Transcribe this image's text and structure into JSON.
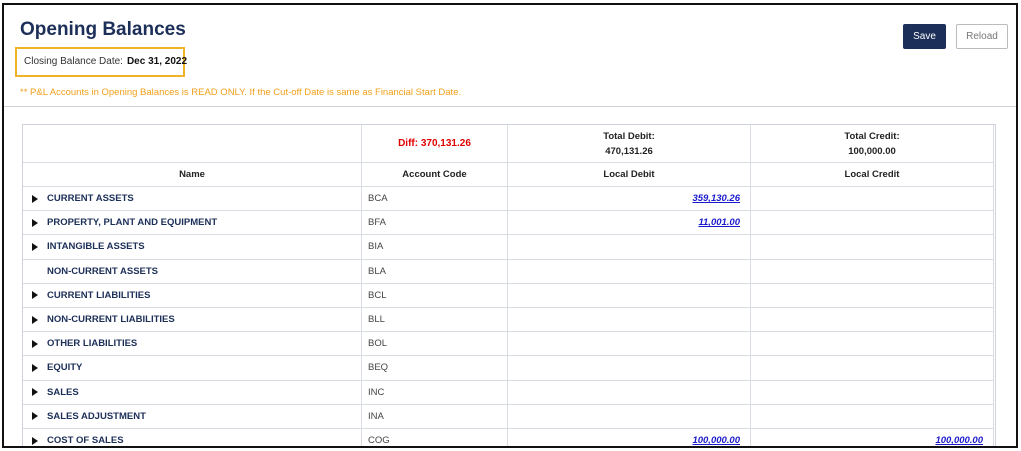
{
  "page": {
    "title": "Opening Balances",
    "closing_label": "Closing Balance Date:",
    "closing_date": "Dec 31, 2022",
    "note": "** P&L Accounts in Opening Balances is READ ONLY. If the Cut-off Date is same as Financial Start Date."
  },
  "toolbar": {
    "save_label": "Save",
    "reload_label": "Reload"
  },
  "summary": {
    "diff": "Diff: 370,131.26",
    "total_debit_label": "Total Debit:",
    "total_debit_value": "470,131.26",
    "total_credit_label": "Total Credit:",
    "total_credit_value": "100,000.00"
  },
  "columns": {
    "name": "Name",
    "code": "Account Code",
    "debit": "Local Debit",
    "credit": "Local Credit"
  },
  "rows": [
    {
      "name": "CURRENT ASSETS",
      "code": "BCA",
      "debit": "359,130.26",
      "credit": "",
      "expandable": true
    },
    {
      "name": "PROPERTY, PLANT AND EQUIPMENT",
      "code": "BFA",
      "debit": "11,001.00",
      "credit": "",
      "expandable": true
    },
    {
      "name": "INTANGIBLE ASSETS",
      "code": "BIA",
      "debit": "",
      "credit": "",
      "expandable": true
    },
    {
      "name": "NON-CURRENT ASSETS",
      "code": "BLA",
      "debit": "",
      "credit": "",
      "expandable": false
    },
    {
      "name": "CURRENT LIABILITIES",
      "code": "BCL",
      "debit": "",
      "credit": "",
      "expandable": true
    },
    {
      "name": "NON-CURRENT LIABILITIES",
      "code": "BLL",
      "debit": "",
      "credit": "",
      "expandable": true
    },
    {
      "name": "OTHER LIABILITIES",
      "code": "BOL",
      "debit": "",
      "credit": "",
      "expandable": true
    },
    {
      "name": "EQUITY",
      "code": "BEQ",
      "debit": "",
      "credit": "",
      "expandable": true
    },
    {
      "name": "SALES",
      "code": "INC",
      "debit": "",
      "credit": "",
      "expandable": true
    },
    {
      "name": "SALES ADJUSTMENT",
      "code": "INA",
      "debit": "",
      "credit": "",
      "expandable": true
    },
    {
      "name": "COST OF SALES",
      "code": "COG",
      "debit": "100,000.00",
      "credit": "100,000.00",
      "expandable": true
    }
  ],
  "colors": {
    "brand": "#1c2f58",
    "highlight": "#f0b323",
    "diff": "#e00000",
    "link": "#1a1acc"
  }
}
